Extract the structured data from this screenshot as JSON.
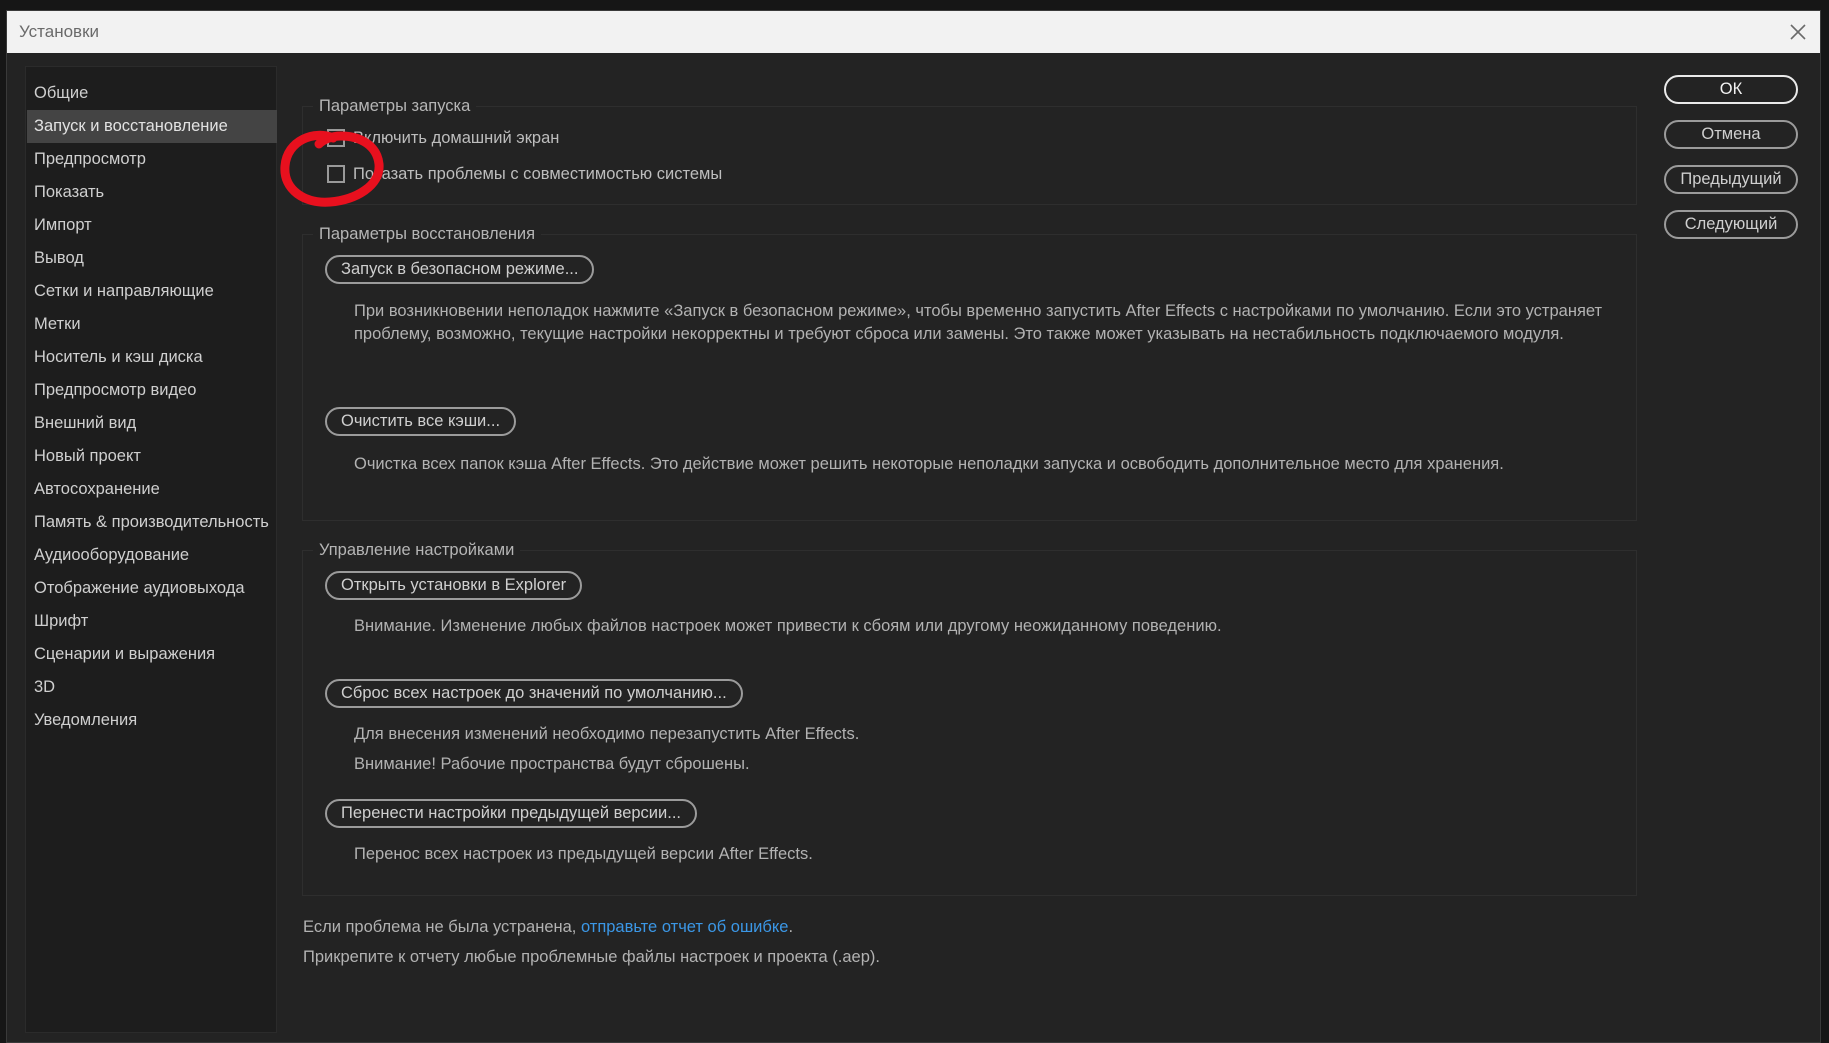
{
  "window": {
    "title": "Установки",
    "close_icon": "close-icon"
  },
  "sidebar": {
    "items": [
      {
        "label": "Общие"
      },
      {
        "label": "Запуск и восстановление",
        "active": true
      },
      {
        "label": "Предпросмотр"
      },
      {
        "label": "Показать"
      },
      {
        "label": "Импорт"
      },
      {
        "label": "Вывод"
      },
      {
        "label": "Сетки и направляющие"
      },
      {
        "label": "Метки"
      },
      {
        "label": "Носитель и кэш диска"
      },
      {
        "label": "Предпросмотр видео"
      },
      {
        "label": "Внешний вид"
      },
      {
        "label": "Новый проект"
      },
      {
        "label": "Автосохранение"
      },
      {
        "label": "Память & производительность"
      },
      {
        "label": "Аудиооборудование"
      },
      {
        "label": "Отображение аудиовыхода"
      },
      {
        "label": "Шрифт"
      },
      {
        "label": "Сценарии и выражения"
      },
      {
        "label": "3D"
      },
      {
        "label": "Уведомления"
      }
    ]
  },
  "startup": {
    "title": "Параметры запуска",
    "home_screen": {
      "label": "Включить домашний экран",
      "checked": false
    },
    "compat": {
      "label": "Показать проблемы с совместимостью системы",
      "checked": false
    }
  },
  "recovery": {
    "title": "Параметры восстановления",
    "safe_mode_button": "Запуск в безопасном режиме...",
    "safe_mode_desc": "При возникновении неполадок нажмите «Запуск в безопасном режиме», чтобы временно запустить After Effects с настройками по умолчанию. Если это устраняет проблему, возможно, текущие настройки некорректны и требуют сброса или замены. Это также может указывать на нестабильность подключаемого модуля.",
    "clear_cache_button": "Очистить все кэши...",
    "clear_cache_desc": "Очистка всех папок кэша After Effects. Это действие может решить некоторые неполадки запуска и освободить дополнительное место для хранения."
  },
  "settings_mgmt": {
    "title": "Управление настройками",
    "open_explorer_button": "Открыть установки в Explorer",
    "open_explorer_desc": "Внимание. Изменение любых файлов настроек может привести к сбоям или другому неожиданному поведению.",
    "reset_button": "Сброс всех настроек до значений по умолчанию...",
    "reset_desc_1": "Для внесения изменений необходимо перезапустить After Effects.",
    "reset_desc_2": "Внимание! Рабочие пространства будут сброшены.",
    "migrate_button": "Перенести настройки предыдущей версии...",
    "migrate_desc": "Перенос всех настроек из предыдущей версии After Effects."
  },
  "footer": {
    "line1_prefix": "Если проблема не была устранена, ",
    "line1_link": "отправьте отчет об ошибке",
    "line1_suffix": ".",
    "line2": "Прикрепите к отчету любые проблемные файлы настроек и проекта (.aep)."
  },
  "buttons": {
    "ok": "ОК",
    "cancel": "Отмена",
    "previous": "Предыдущий",
    "next": "Следующий"
  },
  "colors": {
    "background": "#232323",
    "sidebar_active": "#444444",
    "link": "#3b97e6",
    "annotation": "#e8101e"
  }
}
